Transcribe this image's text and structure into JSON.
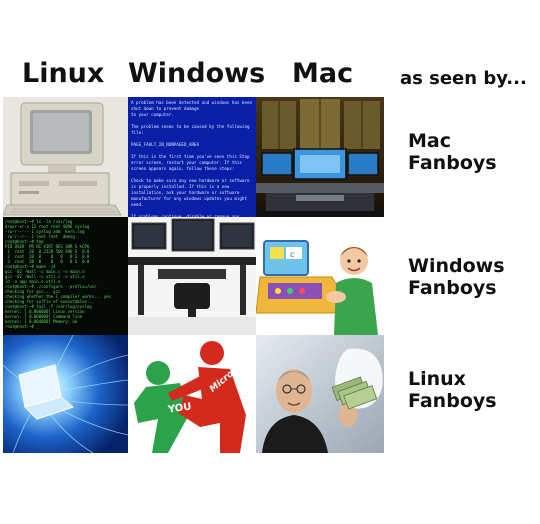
{
  "headers": {
    "linux": "Linux",
    "windows": "Windows",
    "mac": "Mac",
    "seen_by": "as seen by..."
  },
  "rows": [
    {
      "label_line1": "Mac",
      "label_line2": "Fanboys"
    },
    {
      "label_line1": "Windows",
      "label_line2": "Fanboys"
    },
    {
      "label_line1": "Linux",
      "label_line2": "Fanboys"
    }
  ],
  "cells": {
    "windows_mac_fans_text": "A problem has been detected and windows has been shut down to prevent damage\nto your computer.\n\nThe problem seems to be caused by the following file:\n\nPAGE_FAULT_IN_NONPAGED_AREA\n\nIf this is the first time you've seen this Stop error screen, restart your computer. If this screen appears again, follow these steps:\n\nCheck to make sure any new hardware or software is properly installed. If this is a new installation, ask your hardware or software manufacturer for any windows updates you might need.\n\nIf problems continue, disable or remove any newly installed hardware or software. Disable BIOS memory options such as caching or shadowing. If you need to use Safe Mode to remove or disable components, restart your computer, press F8 to select Advanced Startup Options, and then select Safe Mode.\n\nTechnical information:\n\n*** STOP: 0x00000050 (0xFD3094C2,0x00000001,0xFBFE7617,0x00000000)",
    "linux_win_fans_text": "root@host:~# ls -la /var/log\ndrwxr-xr-x 12 root root 4096 syslog\n-rw-r----- 1 syslog adm  kern.log\n-rw-r--r-- 1 root root  dmesg\nroot@host:~# top\nPID USER  PR NI VIRT RES SHR S %CPU\n 1  root  20  0 2328 568 496 S  0.0\n 2  root  20  0    0   0   0 S  0.0\n 3  root  20  0    0   0   0 S  0.0\nroot@host:~# make -j4\ngcc -O2 -Wall -c main.c -o main.o\ngcc -O2 -Wall -c util.c -o util.o\nld -o app main.o util.o\nroot@host:~# ./configure --prefix=/usr\nchecking for gcc... gcc\nchecking whether the C compiler works... yes\nchecking for suffix of executables...\nroot@host:~# tail -f /var/log/syslog\nkernel: [ 0.000000] Linux version\nkernel: [ 0.000000] Command line\nkernel: [ 0.004000] Memory: ok\nroot@host:~# _",
    "you_label": "YOU",
    "microsoft_label": "Microsoft"
  }
}
